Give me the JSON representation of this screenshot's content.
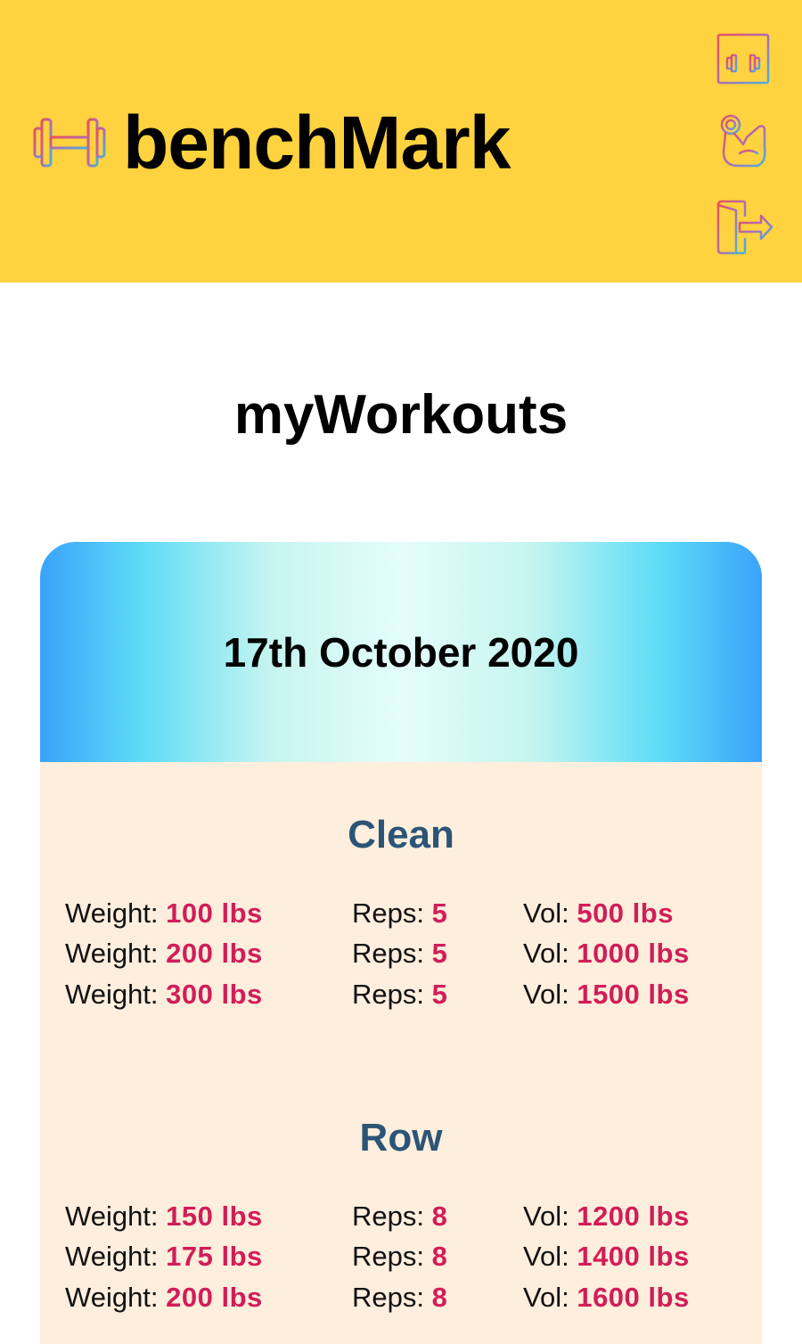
{
  "header": {
    "app_title": "benchMark",
    "icons": [
      "dumbbell-icon",
      "calendar-dumbbell-icon",
      "flexed-arm-icon",
      "logout-icon"
    ]
  },
  "page": {
    "title": "myWorkouts"
  },
  "workout": {
    "date": "17th October 2020",
    "labels": {
      "weight": "Weight: ",
      "reps": "Reps: ",
      "vol": "Vol: "
    },
    "exercises": [
      {
        "name": "Clean",
        "sets": [
          {
            "weight": "100 lbs",
            "reps": "5",
            "vol": "500 lbs"
          },
          {
            "weight": "200 lbs",
            "reps": "5",
            "vol": "1000 lbs"
          },
          {
            "weight": "300 lbs",
            "reps": "5",
            "vol": "1500 lbs"
          }
        ]
      },
      {
        "name": "Row",
        "sets": [
          {
            "weight": "150 lbs",
            "reps": "8",
            "vol": "1200 lbs"
          },
          {
            "weight": "175 lbs",
            "reps": "8",
            "vol": "1400 lbs"
          },
          {
            "weight": "200 lbs",
            "reps": "8",
            "vol": "1600 lbs"
          }
        ]
      }
    ]
  },
  "colors": {
    "header_bg": "#FFD23F",
    "exercise_name": "#2B5577",
    "value_accent": "#D21D57",
    "card_body_bg": "#FDEEDD"
  }
}
